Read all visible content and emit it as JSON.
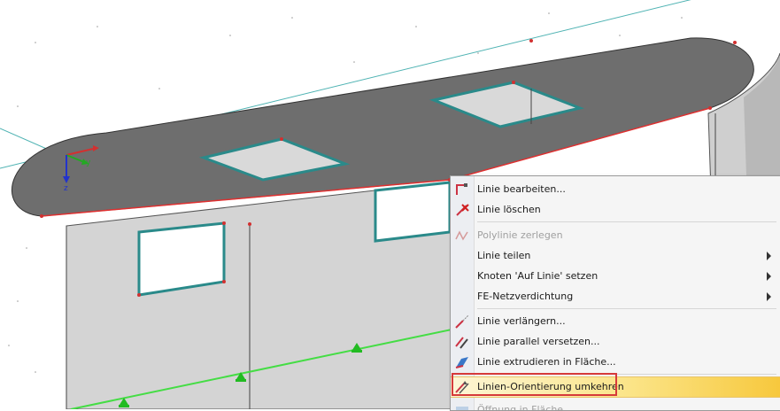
{
  "viewport": {
    "axes": {
      "y_label": "y",
      "z_label": "z"
    }
  },
  "context_menu": {
    "items": [
      {
        "label": "Linie bearbeiten...",
        "icon": "edit-line-icon",
        "disabled": false,
        "submenu": false
      },
      {
        "label": "Linie löschen",
        "icon": "delete-line-icon",
        "disabled": false,
        "submenu": false
      },
      {
        "label": "Polylinie zerlegen",
        "icon": "explode-polyline-icon",
        "disabled": true,
        "submenu": false
      },
      {
        "label": "Linie teilen",
        "icon": "",
        "disabled": false,
        "submenu": true
      },
      {
        "label": "Knoten 'Auf Linie' setzen",
        "icon": "",
        "disabled": false,
        "submenu": true
      },
      {
        "label": "FE-Netzverdichtung",
        "icon": "",
        "disabled": false,
        "submenu": true
      },
      {
        "label": "Linie verlängern...",
        "icon": "extend-line-icon",
        "disabled": false,
        "submenu": false
      },
      {
        "label": "Linie parallel versetzen...",
        "icon": "offset-line-icon",
        "disabled": false,
        "submenu": false
      },
      {
        "label": "Linie extrudieren in Fläche...",
        "icon": "extrude-line-icon",
        "disabled": false,
        "submenu": false
      },
      {
        "label": "Linien-Orientierung umkehren",
        "icon": "reverse-orientation-icon",
        "disabled": false,
        "submenu": false,
        "highlighted": true
      },
      {
        "label": "Öffnung in Fläche...",
        "icon": "opening-icon",
        "disabled": true,
        "submenu": false
      }
    ],
    "highlight_color": "#f7c83d",
    "callout_color": "#d63a3a"
  }
}
